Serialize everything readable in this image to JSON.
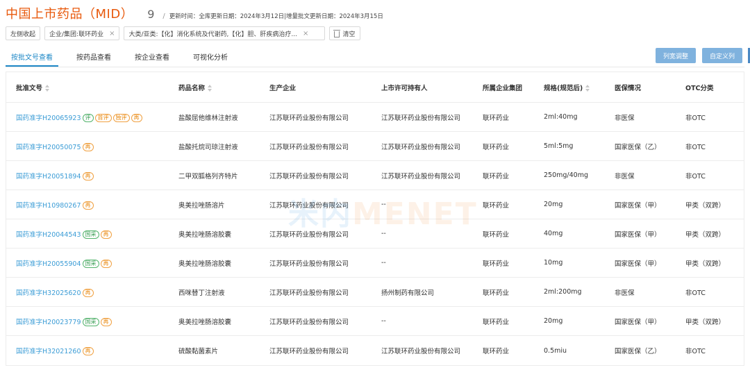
{
  "header": {
    "title": "中国上市药品（MID）",
    "count": "9",
    "separator": "/",
    "update_info": "更新时间：全库更新日期：2024年3月12日|增量批文更新日期：2024年3月15日"
  },
  "filters": {
    "collapse_label": "左侧收起",
    "chip_company": "企业/集团:联环药业",
    "chip_category": "大类/亚类:【化】消化系统及代谢药,【化】胆、肝疾病治疗...",
    "clear_label": "清空"
  },
  "tabs": [
    "按批文号查看",
    "按药品查看",
    "按企业查看",
    "可视化分析"
  ],
  "active_tab": 0,
  "buttons": {
    "column_adjust": "列宽调整",
    "custom_columns": "自定义列"
  },
  "table": {
    "headers": [
      "批准文号",
      "药品名称",
      "生产企业",
      "上市许可持有人",
      "所属企业集团",
      "规格(规范后)",
      "医保情况",
      "OTC分类"
    ],
    "rows": [
      {
        "approval": "国药准字H20065923",
        "tags": [
          {
            "t": "评",
            "c": "g"
          },
          {
            "t": "首评",
            "c": "o"
          },
          {
            "t": "独评",
            "c": "o"
          },
          {
            "t": "再",
            "c": "o"
          }
        ],
        "name": "盐酸屈他维林注射液",
        "maker": "江苏联环药业股份有限公司",
        "holder": "江苏联环药业股份有限公司",
        "group": "联环药业",
        "spec": "2ml:40mg",
        "insurance": "非医保",
        "otc": "非OTC"
      },
      {
        "approval": "国药准字H20050075",
        "tags": [
          {
            "t": "再",
            "c": "o"
          }
        ],
        "name": "盐酸托烷司琼注射液",
        "maker": "江苏联环药业股份有限公司",
        "holder": "江苏联环药业股份有限公司",
        "group": "联环药业",
        "spec": "5ml:5mg",
        "insurance": "国家医保（乙）",
        "otc": "非OTC"
      },
      {
        "approval": "国药准字H20051894",
        "tags": [
          {
            "t": "再",
            "c": "o"
          }
        ],
        "name": "二甲双胍格列齐特片",
        "maker": "江苏联环药业股份有限公司",
        "holder": "江苏联环药业股份有限公司",
        "group": "联环药业",
        "spec": "250mg/40mg",
        "insurance": "非医保",
        "otc": "非OTC"
      },
      {
        "approval": "国药准字H10980267",
        "tags": [
          {
            "t": "再",
            "c": "o"
          }
        ],
        "name": "奥美拉唑肠溶片",
        "maker": "江苏联环药业股份有限公司",
        "holder": "--",
        "group": "联环药业",
        "spec": "20mg",
        "insurance": "国家医保（甲）",
        "otc": "甲类（双跨）"
      },
      {
        "approval": "国药准字H20044543",
        "tags": [
          {
            "t": "国采",
            "c": "g"
          },
          {
            "t": "再",
            "c": "o"
          }
        ],
        "name": "奥美拉唑肠溶胶囊",
        "maker": "江苏联环药业股份有限公司",
        "holder": "--",
        "group": "联环药业",
        "spec": "40mg",
        "insurance": "国家医保（甲）",
        "otc": "甲类（双跨）"
      },
      {
        "approval": "国药准字H20055904",
        "tags": [
          {
            "t": "国采",
            "c": "g"
          },
          {
            "t": "再",
            "c": "o"
          }
        ],
        "name": "奥美拉唑肠溶胶囊",
        "maker": "江苏联环药业股份有限公司",
        "holder": "--",
        "group": "联环药业",
        "spec": "10mg",
        "insurance": "国家医保（甲）",
        "otc": "甲类（双跨）"
      },
      {
        "approval": "国药准字H32025620",
        "tags": [
          {
            "t": "再",
            "c": "o"
          }
        ],
        "name": "西咪替丁注射液",
        "maker": "江苏联环药业股份有限公司",
        "holder": "扬州制药有限公司",
        "group": "联环药业",
        "spec": "2ml:200mg",
        "insurance": "非医保",
        "otc": "非OTC"
      },
      {
        "approval": "国药准字H20023779",
        "tags": [
          {
            "t": "国采",
            "c": "g"
          },
          {
            "t": "再",
            "c": "o"
          }
        ],
        "name": "奥美拉唑肠溶胶囊",
        "maker": "江苏联环药业股份有限公司",
        "holder": "--",
        "group": "联环药业",
        "spec": "20mg",
        "insurance": "国家医保（甲）",
        "otc": "甲类（双跨）"
      },
      {
        "approval": "国药准字H32021260",
        "tags": [
          {
            "t": "再",
            "c": "o"
          }
        ],
        "name": "硫酸黏菌素片",
        "maker": "江苏联环药业股份有限公司",
        "holder": "江苏联环药业股份有限公司",
        "group": "联环药业",
        "spec": "0.5miu",
        "insurance": "国家医保（乙）",
        "otc": "非OTC"
      }
    ]
  },
  "watermark": {
    "cn": "米内",
    "en": "MENET"
  },
  "colors": {
    "accent": "#e8590c",
    "link": "#3b9cd6",
    "button": "#7fb2de",
    "tab_active": "#1e88c7"
  }
}
